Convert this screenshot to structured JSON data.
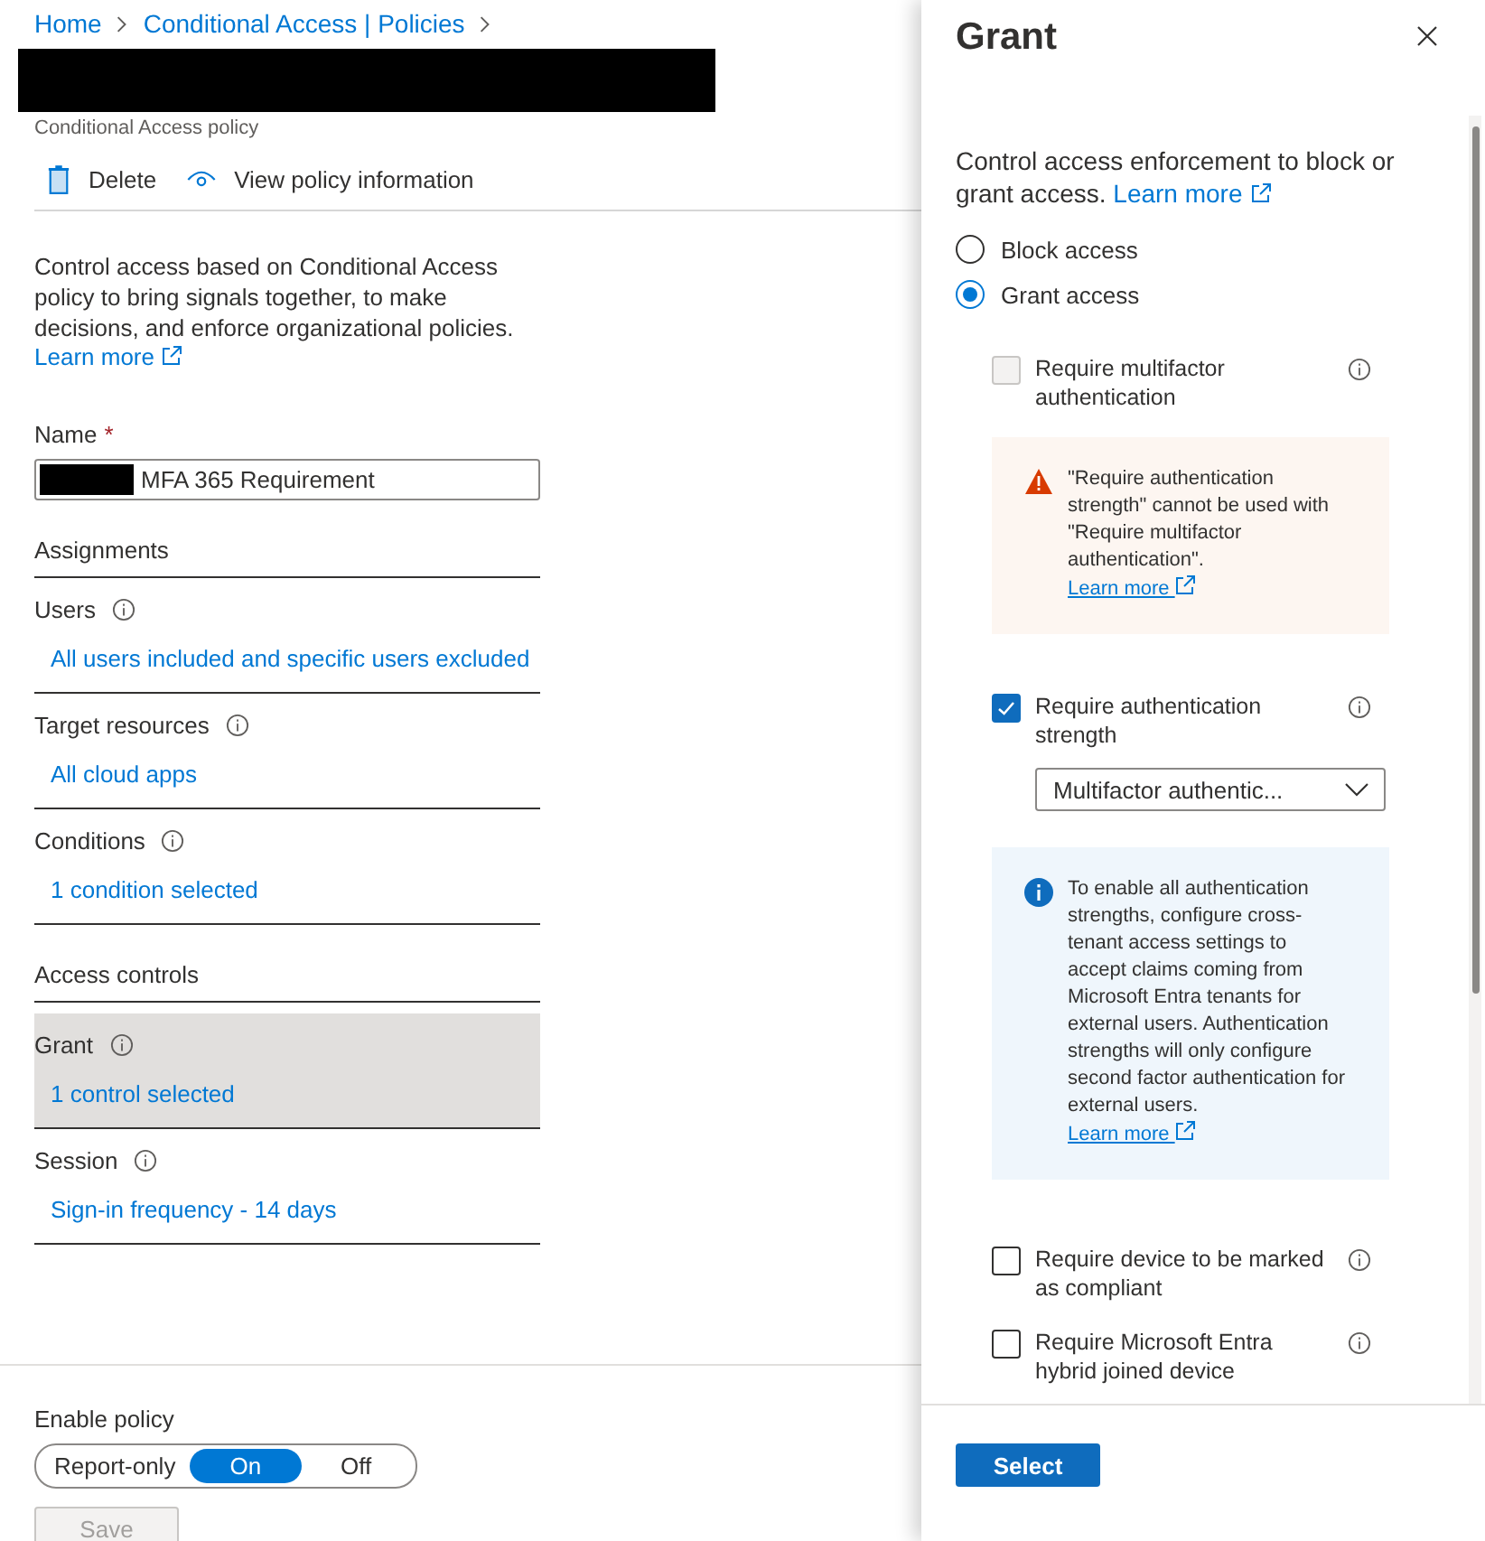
{
  "breadcrumb": [
    {
      "label": "Home"
    },
    {
      "label": "Conditional Access | Policies"
    }
  ],
  "subtitle": "Conditional Access policy",
  "toolbar": [
    {
      "kind": "delete",
      "label": "Delete"
    },
    {
      "kind": "view",
      "label": "View policy information"
    }
  ],
  "description": {
    "text": "Control access based on Conditional Access policy to bring signals together, to make decisions, and enforce organizational policies.",
    "link": "Learn more"
  },
  "name_field": {
    "label": "Name",
    "required_mark": "*",
    "value": "MFA 365 Requirement"
  },
  "sections": [
    {
      "heading": "Assignments",
      "items": [
        {
          "label": "Users",
          "value": "All users included and specific users excluded",
          "selected": false
        },
        {
          "label": "Target resources",
          "value": "All cloud apps",
          "selected": false
        },
        {
          "label": "Conditions",
          "value": "1 condition selected",
          "selected": false
        }
      ]
    },
    {
      "heading": "Access controls",
      "items": [
        {
          "label": "Grant",
          "value": "1 control selected",
          "selected": true
        },
        {
          "label": "Session",
          "value": "Sign-in frequency - 14 days",
          "selected": false
        }
      ]
    }
  ],
  "enable_policy": {
    "label": "Enable policy",
    "options": [
      {
        "label": "Report-only",
        "selected": false
      },
      {
        "label": "On",
        "selected": true
      },
      {
        "label": "Off",
        "selected": false
      }
    ]
  },
  "save_button": {
    "label": "Save",
    "disabled": true
  },
  "grant_panel": {
    "title": "Grant",
    "intro": "Control access enforcement to block or grant access.",
    "intro_link": "Learn more",
    "radios": [
      {
        "label": "Block access",
        "selected": false
      },
      {
        "label": "Grant access",
        "selected": true
      }
    ],
    "options": [
      {
        "kind": "checkbox",
        "label": "Require multifactor authentication",
        "checked": false,
        "disabled": true
      },
      {
        "kind": "warning",
        "text": "\"Require authentication strength\" cannot be used with \"Require multifactor authentication\".",
        "link": "Learn more"
      },
      {
        "kind": "checkbox",
        "label": "Require authentication strength",
        "checked": true,
        "disabled": false,
        "dropdown": "Multifactor authentic..."
      },
      {
        "kind": "info",
        "text": "To enable all authentication strengths, configure cross-tenant access settings to accept claims coming from Microsoft Entra tenants for external users. Authentication strengths will only configure second factor authentication for external users.",
        "link": "Learn more"
      },
      {
        "kind": "checkbox",
        "label": "Require device to be marked as compliant",
        "checked": false,
        "disabled": false
      },
      {
        "kind": "checkbox",
        "label": "Require Microsoft Entra hybrid joined device",
        "checked": false,
        "disabled": false
      }
    ],
    "select_button": "Select"
  }
}
